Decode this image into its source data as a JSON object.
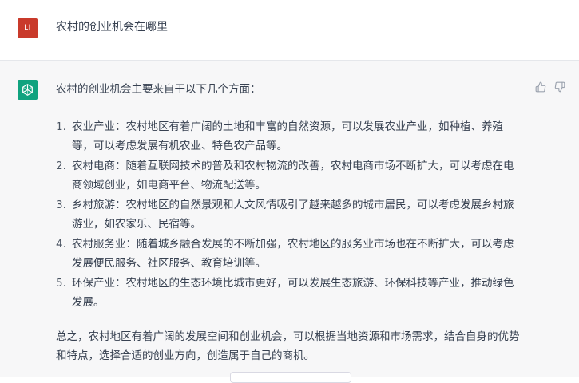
{
  "user": {
    "avatar_initials": "LI",
    "avatar_color": "#c93a2b",
    "question": "农村的创业机会在哪里"
  },
  "assistant": {
    "avatar_icon": "openai-logo-icon",
    "avatar_color": "#10a37f",
    "intro": "农村的创业机会主要来自于以下几个方面：",
    "items": [
      {
        "num": "1.",
        "text": "农业产业：农村地区有着广阔的土地和丰富的自然资源，可以发展农业产业，如种植、养殖等，可以考虑发展有机农业、特色农产品等。"
      },
      {
        "num": "2.",
        "text": "农村电商：随着互联网技术的普及和农村物流的改善，农村电商市场不断扩大，可以考虑在电商领域创业，如电商平台、物流配送等。"
      },
      {
        "num": "3.",
        "text": "乡村旅游：农村地区的自然景观和人文风情吸引了越来越多的城市居民，可以考虑发展乡村旅游业，如农家乐、民宿等。"
      },
      {
        "num": "4.",
        "text": "农村服务业：随着城乡融合发展的不断加强，农村地区的服务业市场也在不断扩大，可以考虑发展便民服务、社区服务、教育培训等。"
      },
      {
        "num": "5.",
        "text": "环保产业：农村地区的生态环境比城市更好，可以发展生态旅游、环保科技等产业，推动绿色发展。"
      }
    ],
    "conclusion": "总之，农村地区有着广阔的发展空间和创业机会，可以根据当地资源和市场需求，结合自身的优势和特点，选择合适的创业方向，创造属于自己的商机。"
  },
  "feedback": {
    "up_icon": "thumbs-up-icon",
    "down_icon": "thumbs-down-icon"
  }
}
